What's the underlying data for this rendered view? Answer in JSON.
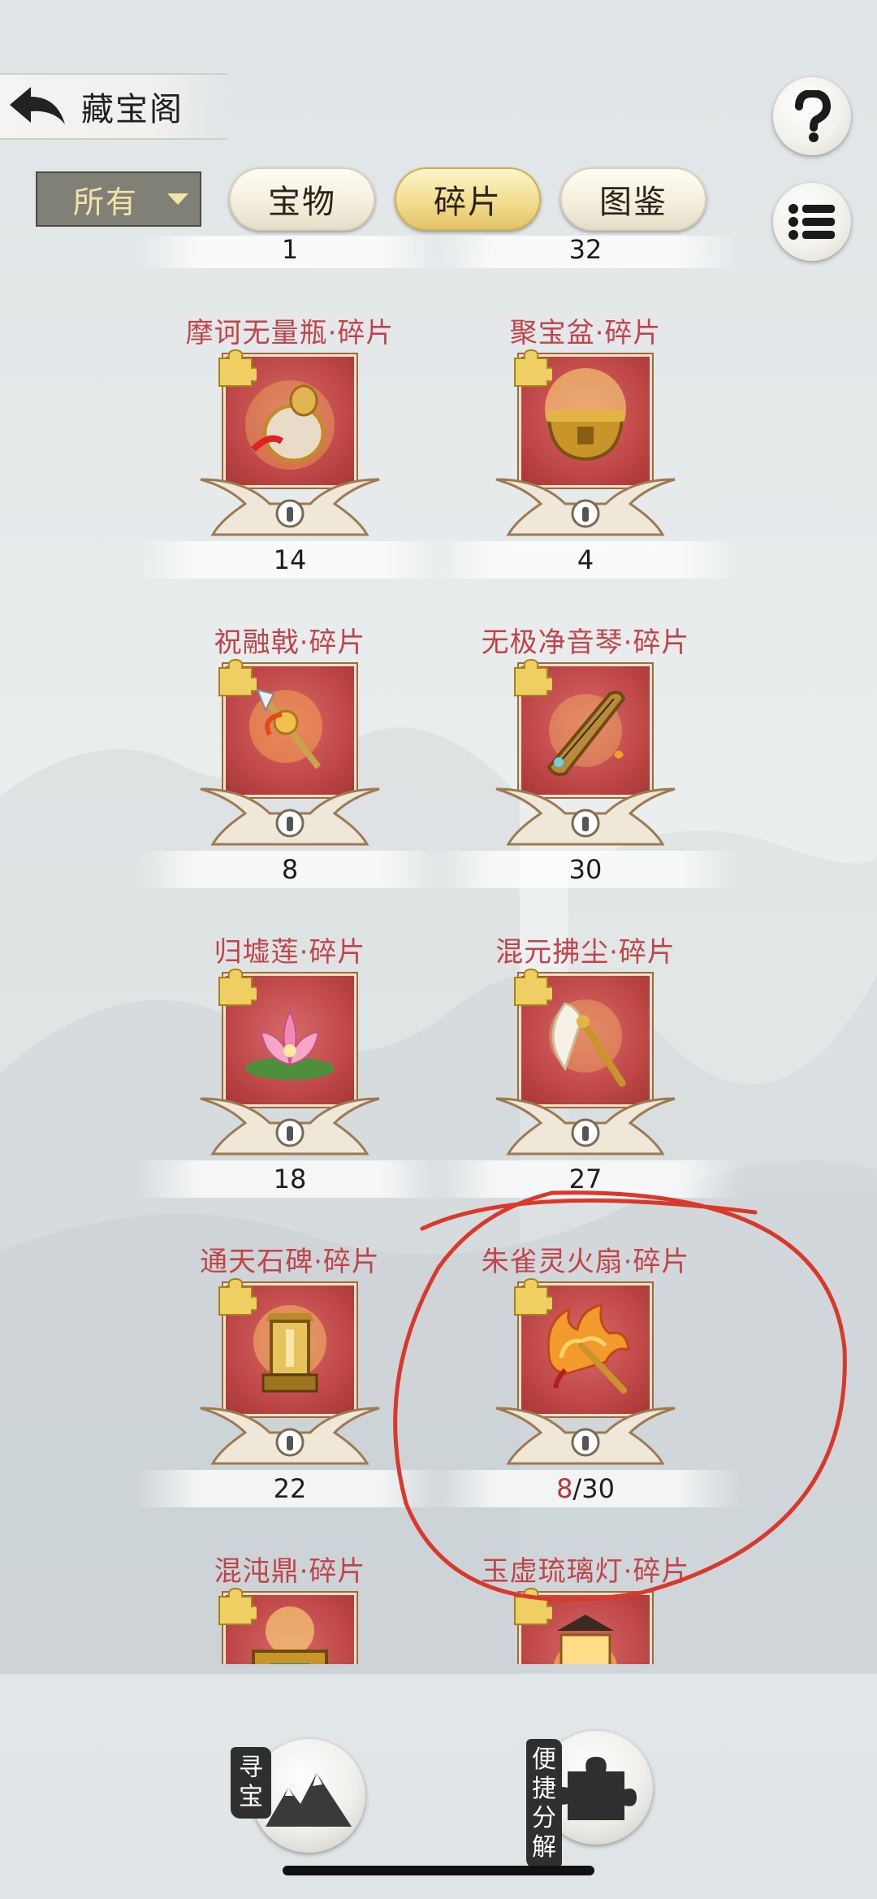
{
  "header": {
    "title": "藏宝阁"
  },
  "filter": {
    "selected": "所有"
  },
  "tabs": [
    {
      "label": "宝物",
      "active": false
    },
    {
      "label": "碎片",
      "active": true
    },
    {
      "label": "图鉴",
      "active": false
    }
  ],
  "top_counts": [
    "1",
    "32"
  ],
  "items": [
    {
      "name": "摩诃无量瓶·碎片",
      "count": "14",
      "icon": "gourd-icon"
    },
    {
      "name": "聚宝盆·碎片",
      "count": "4",
      "icon": "treasure-bowl-icon"
    },
    {
      "name": "祝融戟·碎片",
      "count": "8",
      "icon": "halberd-icon"
    },
    {
      "name": "无极净音琴·碎片",
      "count": "30",
      "icon": "zither-icon"
    },
    {
      "name": "归墟莲·碎片",
      "count": "18",
      "icon": "lotus-icon"
    },
    {
      "name": "混元拂尘·碎片",
      "count": "27",
      "icon": "whisk-icon"
    },
    {
      "name": "通天石碑·碎片",
      "count": "22",
      "icon": "stele-icon"
    },
    {
      "name": "朱雀灵火扇·碎片",
      "count_have": "8",
      "count_need": "/30",
      "icon": "fire-fan-icon"
    },
    {
      "name": "混沌鼎·碎片",
      "count": "",
      "icon": "cauldron-icon"
    },
    {
      "name": "玉虚琉璃灯·碎片",
      "count": "",
      "icon": "lantern-icon"
    }
  ],
  "bottom": {
    "seek_label": "寻宝",
    "decompose_label": "便捷分解"
  }
}
